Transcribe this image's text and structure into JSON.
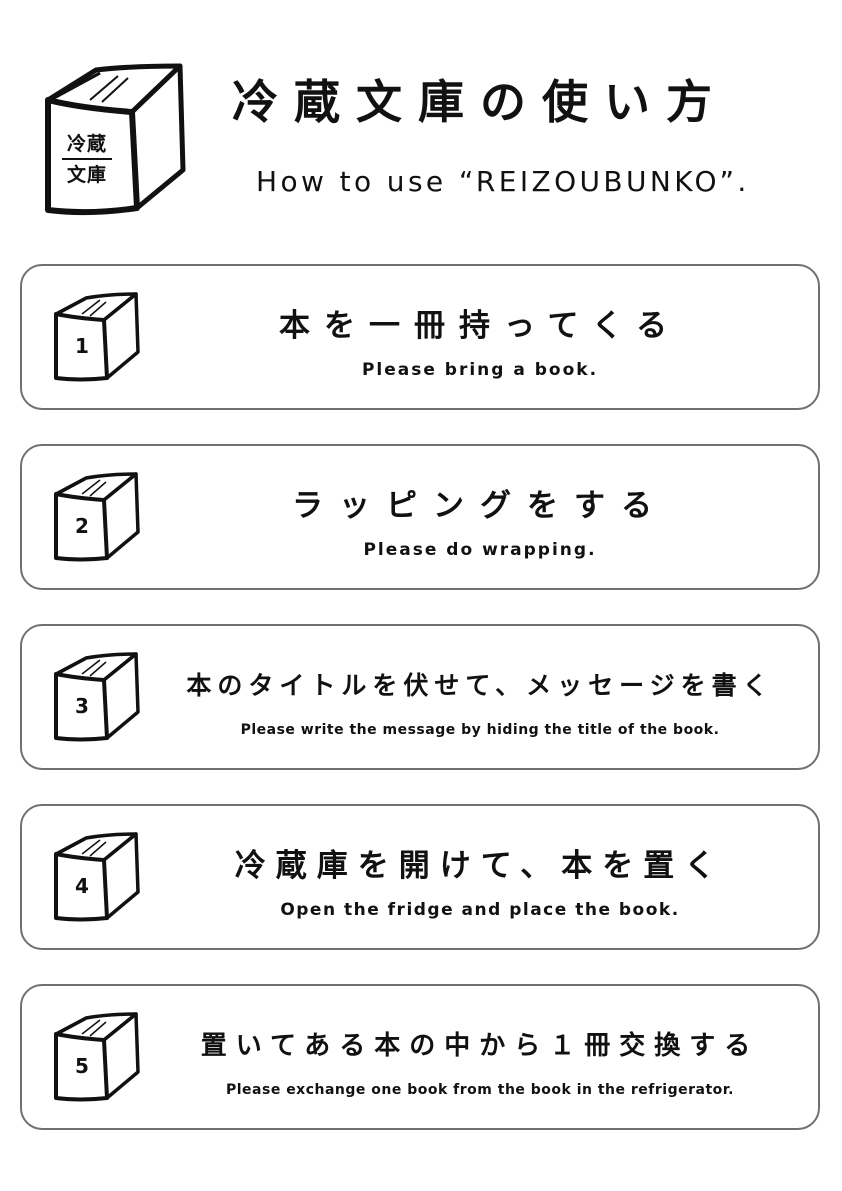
{
  "header": {
    "logo_text_top": "冷蔵",
    "logo_text_bottom": "文庫",
    "title": "冷蔵文庫の使い方",
    "subtitle": "How to use “REIZOUBUNKO”."
  },
  "steps": [
    {
      "number": "1",
      "title": "本を一冊持ってくる",
      "subtitle": "Please bring a book."
    },
    {
      "number": "2",
      "title": "ラッピングをする",
      "subtitle": "Please do wrapping."
    },
    {
      "number": "3",
      "title": "本のタイトルを伏せて、メッセージを書く",
      "subtitle": "Please write the message by hiding the title of the book."
    },
    {
      "number": "4",
      "title": "冷蔵庫を開けて、本を置く",
      "subtitle": "Open the fridge and place the book."
    },
    {
      "number": "5",
      "title": "置いてある本の中から１冊交換する",
      "subtitle": "Please exchange one book from the book in the refrigerator."
    }
  ]
}
